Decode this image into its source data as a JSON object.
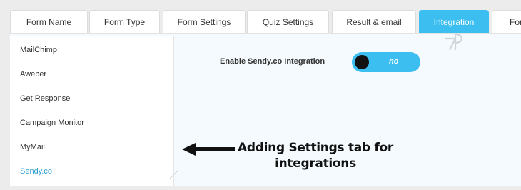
{
  "tabs": [
    {
      "label": "Form Name",
      "active": false
    },
    {
      "label": "Form Type",
      "active": false
    },
    {
      "label": "Form Settings",
      "active": false
    },
    {
      "label": "Quiz Settings",
      "active": false
    },
    {
      "label": "Result & email",
      "active": false
    },
    {
      "label": "Integration",
      "active": true
    },
    {
      "label": "For",
      "active": false
    }
  ],
  "sidebar": {
    "items": [
      {
        "label": "MailChimp"
      },
      {
        "label": "Aweber"
      },
      {
        "label": "Get Response"
      },
      {
        "label": "Campaign Monitor"
      },
      {
        "label": "MyMail"
      },
      {
        "label": "Sendy.co",
        "active": true
      }
    ]
  },
  "integration": {
    "enable_label": "Enable Sendy.co Integration",
    "toggle_state": "no"
  },
  "annotation": {
    "line1": "Adding Settings tab for",
    "line2": "integrations"
  },
  "colors": {
    "accent": "#3cbff0",
    "active_link": "#2e9fcf",
    "panel_bg": "#f4fafd"
  },
  "icons": {
    "logo": "wp-logo-icon",
    "arrow": "arrow-left-icon"
  }
}
